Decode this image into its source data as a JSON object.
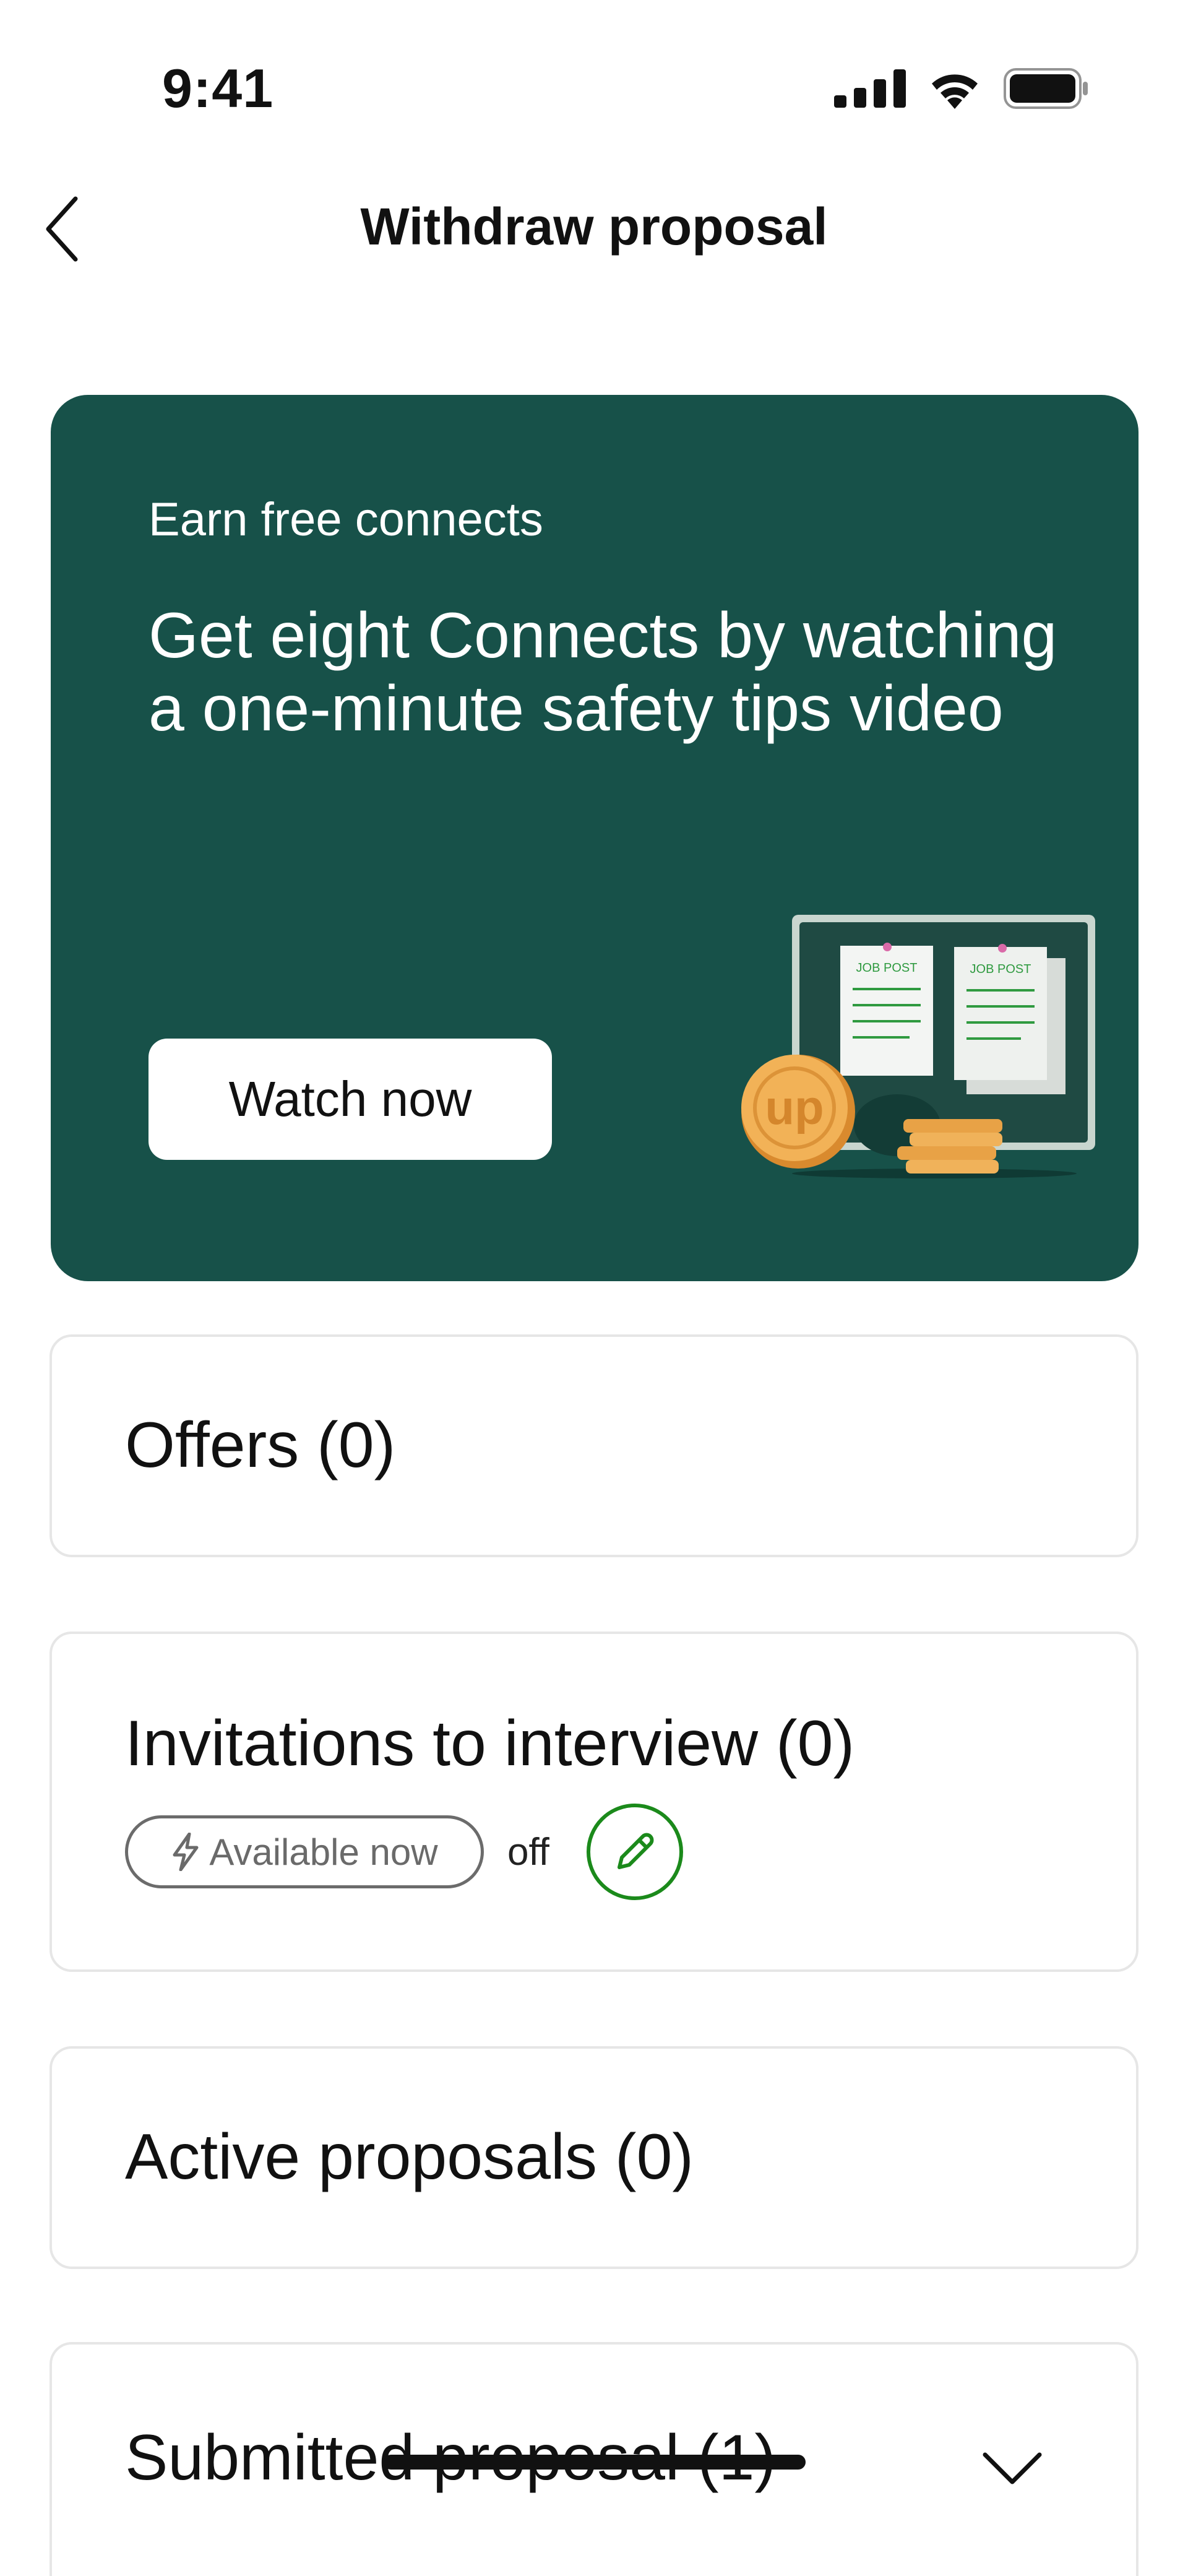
{
  "status_bar": {
    "time": "9:41",
    "icons": [
      "cellular-signal-icon",
      "wifi-icon",
      "battery-icon"
    ]
  },
  "nav": {
    "back_icon": "chevron-left-icon",
    "title": "Withdraw proposal"
  },
  "promo": {
    "eyebrow": "Earn free connects",
    "headline": "Get eight Connects by watching a one-minute safety tips video",
    "button_label": "Watch now",
    "illustration": {
      "sign_text_1": "JOB POST",
      "sign_text_2": "JOB POST",
      "coin_text": "up"
    },
    "colors": {
      "background": "#175149",
      "button": "#ffffff"
    }
  },
  "sections": {
    "offers": {
      "label": "Offers  (0)"
    },
    "invitations": {
      "label": "Invitations to interview (0)",
      "availability_label": "Available now",
      "availability_state": "off",
      "edit_icon": "pencil-icon"
    },
    "active": {
      "label": "Active proposals  (0)"
    },
    "submitted": {
      "label": "Submitted proposal  (1)",
      "chevron_icon": "chevron-down-icon"
    }
  },
  "accent_colors": {
    "edit_green": "#1b8a1b",
    "card_border": "#e6e6e6"
  }
}
